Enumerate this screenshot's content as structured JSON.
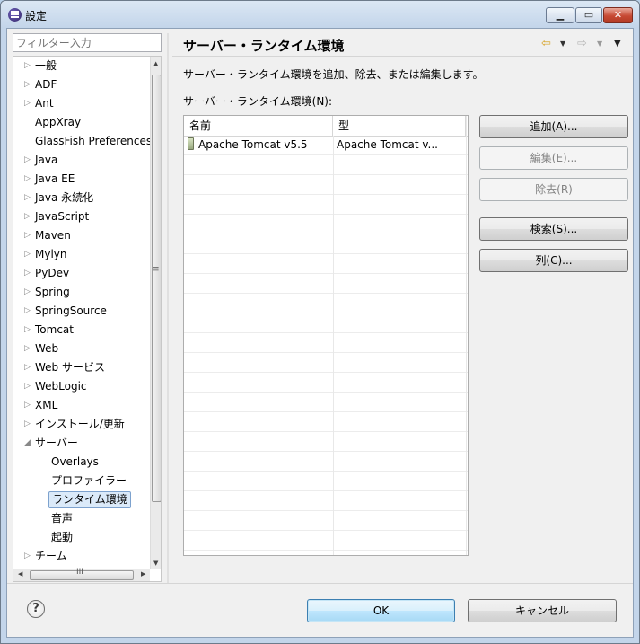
{
  "window": {
    "title": "設定"
  },
  "filter": {
    "placeholder": "フィルター入力"
  },
  "tree": {
    "items": [
      {
        "label": "一般",
        "arrow": "▷",
        "child": false,
        "selected": false
      },
      {
        "label": "ADF",
        "arrow": "▷",
        "child": false,
        "selected": false
      },
      {
        "label": "Ant",
        "arrow": "▷",
        "child": false,
        "selected": false
      },
      {
        "label": "AppXray",
        "arrow": "",
        "child": false,
        "selected": false
      },
      {
        "label": "GlassFish Preferences",
        "arrow": "",
        "child": false,
        "selected": false
      },
      {
        "label": "Java",
        "arrow": "▷",
        "child": false,
        "selected": false
      },
      {
        "label": "Java EE",
        "arrow": "▷",
        "child": false,
        "selected": false
      },
      {
        "label": "Java 永続化",
        "arrow": "▷",
        "child": false,
        "selected": false
      },
      {
        "label": "JavaScript",
        "arrow": "▷",
        "child": false,
        "selected": false
      },
      {
        "label": "Maven",
        "arrow": "▷",
        "child": false,
        "selected": false
      },
      {
        "label": "Mylyn",
        "arrow": "▷",
        "child": false,
        "selected": false
      },
      {
        "label": "PyDev",
        "arrow": "▷",
        "child": false,
        "selected": false
      },
      {
        "label": "Spring",
        "arrow": "▷",
        "child": false,
        "selected": false
      },
      {
        "label": "SpringSource",
        "arrow": "▷",
        "child": false,
        "selected": false
      },
      {
        "label": "Tomcat",
        "arrow": "▷",
        "child": false,
        "selected": false
      },
      {
        "label": "Web",
        "arrow": "▷",
        "child": false,
        "selected": false
      },
      {
        "label": "Web サービス",
        "arrow": "▷",
        "child": false,
        "selected": false
      },
      {
        "label": "WebLogic",
        "arrow": "▷",
        "child": false,
        "selected": false
      },
      {
        "label": "XML",
        "arrow": "▷",
        "child": false,
        "selected": false
      },
      {
        "label": "インストール/更新",
        "arrow": "▷",
        "child": false,
        "selected": false
      },
      {
        "label": "サーバー",
        "arrow": "◢",
        "child": false,
        "selected": false
      },
      {
        "label": "Overlays",
        "arrow": "",
        "child": true,
        "selected": false
      },
      {
        "label": "プロファイラー",
        "arrow": "",
        "child": true,
        "selected": false
      },
      {
        "label": "ランタイム環境",
        "arrow": "",
        "child": true,
        "selected": true
      },
      {
        "label": "音声",
        "arrow": "",
        "child": true,
        "selected": false
      },
      {
        "label": "起動",
        "arrow": "",
        "child": true,
        "selected": false
      },
      {
        "label": "チーム",
        "arrow": "▷",
        "child": false,
        "selected": false
      }
    ],
    "vscroll_grip": "≡",
    "hscroll_grip": "III"
  },
  "page": {
    "title": "サーバー・ランタイム環境",
    "description": "サーバー・ランタイム環境を追加、除去、または編集します。",
    "table_label": "サーバー・ランタイム環境(N):",
    "columns": [
      "名前",
      "型"
    ],
    "rows": [
      {
        "name": "Apache Tomcat v5.5",
        "type": "Apache Tomcat v..."
      }
    ],
    "empty_rows": 21
  },
  "buttons": {
    "add": "追加(A)...",
    "edit": "編集(E)...",
    "remove": "除去(R)",
    "search": "検索(S)...",
    "columns": "列(C)..."
  },
  "footer": {
    "help": "?",
    "ok": "OK",
    "cancel": "キャンセル"
  },
  "nav": {
    "back_icon": "⇦",
    "forward_icon": "⇨",
    "menu_icon": "▼"
  }
}
